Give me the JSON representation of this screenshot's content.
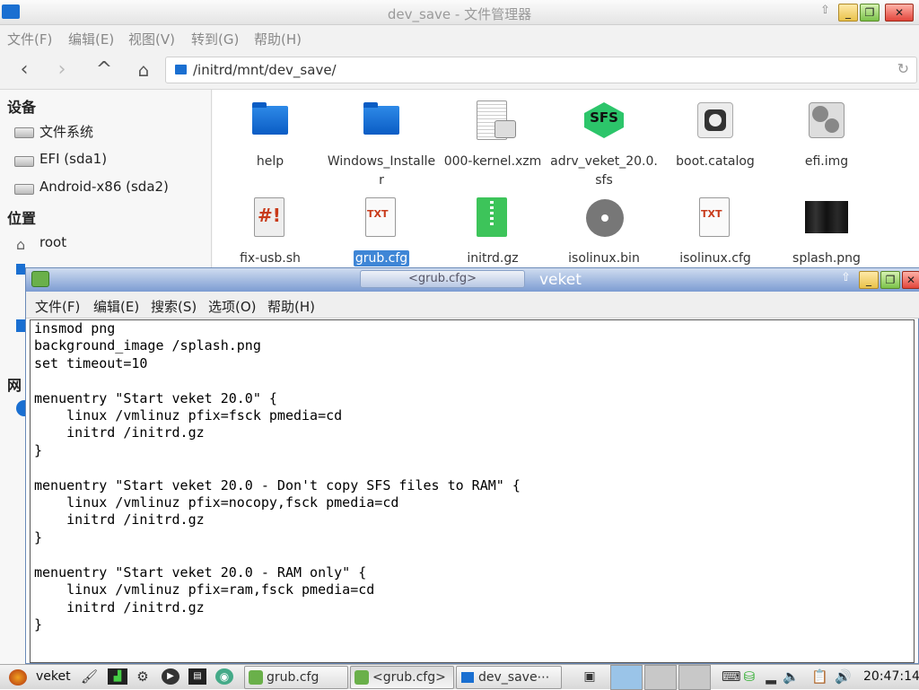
{
  "file_manager": {
    "title": "dev_save - 文件管理器",
    "menu": [
      "文件(F)",
      "编辑(E)",
      "视图(V)",
      "转到(G)",
      "帮助(H)"
    ],
    "address": "/initrd/mnt/dev_save/",
    "sidebar": {
      "devices_header": "设备",
      "devices": [
        "文件系统",
        "EFI (sda1)",
        "Android-x86 (sda2)"
      ],
      "places_header": "位置",
      "places": [
        "root"
      ],
      "network_header": "网"
    },
    "files_row1": [
      "help",
      "Windows_Installer",
      "000-kernel.xzm",
      "adrv_veket_20.0.sfs",
      "boot.catalog",
      "efi.img"
    ],
    "files_row2": [
      "fix-usb.sh",
      "grub.cfg",
      "initrd.gz",
      "isolinux.bin",
      "isolinux.cfg",
      "splash.png"
    ],
    "icon_text": {
      "sfs": "SFS",
      "txt": "TXT",
      "script": "#!"
    }
  },
  "editor": {
    "tab_title": "<grub.cfg>",
    "app_name": "veket",
    "menu": [
      "文件(F)",
      "编辑(E)",
      "搜索(S)",
      "选项(O)",
      "帮助(H)"
    ],
    "content": "insmod png\nbackground_image /splash.png\nset timeout=10\n\nmenuentry \"Start veket 20.0\" {\n    linux /vmlinuz pfix=fsck pmedia=cd\n    initrd /initrd.gz\n}\n\nmenuentry \"Start veket 20.0 - Don't copy SFS files to RAM\" {\n    linux /vmlinuz pfix=nocopy,fsck pmedia=cd\n    initrd /initrd.gz\n}\n\nmenuentry \"Start veket 20.0 - RAM only\" {\n    linux /vmlinuz pfix=ram,fsck pmedia=cd\n    initrd /initrd.gz\n}"
  },
  "taskbar": {
    "start_label": "veket",
    "tasks": [
      "grub.cfg",
      "<grub.cfg>",
      "dev_save⋯"
    ],
    "clock": "20:47:14"
  }
}
